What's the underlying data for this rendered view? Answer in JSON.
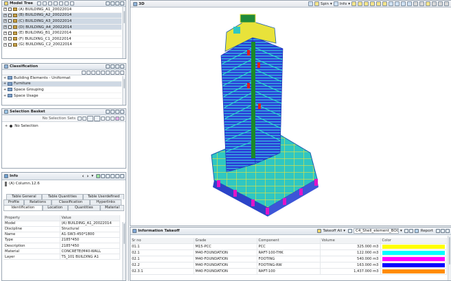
{
  "model_tree": {
    "title": "Model Tree",
    "items": [
      {
        "label": "(A) BUILDING_A1_20022014",
        "selected": false
      },
      {
        "label": "(B) BUILDING_A2_20022014",
        "selected": true
      },
      {
        "label": "(C) BUILDING_A3_20022014",
        "selected": true
      },
      {
        "label": "(D) BUILDING_A4_20022014",
        "selected": true
      },
      {
        "label": "(E) BUILDING_B1_20022014",
        "selected": false
      },
      {
        "label": "(F) BUILDING_C1_20022014",
        "selected": false
      },
      {
        "label": "(G) BUILDING_C2_20022014",
        "selected": false
      }
    ]
  },
  "classification": {
    "title": "Classification",
    "items": [
      "Building Elements - Uniformat",
      "Furniture",
      "Space Grouping",
      "Space Usage"
    ]
  },
  "selection_basket": {
    "title": "Selection Basket",
    "sets_label": "No Selection Sets",
    "no_selection": "No Selection"
  },
  "info": {
    "title": "Info",
    "element": "(A) Column.12.6",
    "tabs_row1": [
      "Table General",
      "Table Quantities",
      "Table Userdefined"
    ],
    "tabs_row2": [
      "Profile",
      "Relations",
      "Classification",
      "Hyperlinks"
    ],
    "tabs_row3": [
      "Identification",
      "Location",
      "Quantities",
      "Material"
    ],
    "headers": [
      "Property",
      "Value"
    ],
    "rows": [
      [
        "Model",
        "(A) BUILDING_A1_20022014"
      ],
      [
        "Discipline",
        "Structural"
      ],
      [
        "Name",
        "A1-SW3-450*1800"
      ],
      [
        "Type",
        "2185*450"
      ],
      [
        "Description",
        "2185*450"
      ],
      [
        "Material",
        "CONCRETE(M40-WALL"
      ],
      [
        "Layer",
        "TS_101 BUILDING A1"
      ]
    ]
  },
  "view3d": {
    "title": "3D",
    "spin": "Spin",
    "info": "Info"
  },
  "takeoff": {
    "title": "Information Takeoff",
    "takeoff_all": "Takeoff All",
    "schema": "C4_Shell_element_BOQ_g...",
    "report": "Report",
    "headers": [
      "Sr no",
      "Grade",
      "Component",
      "Volume",
      "Color"
    ],
    "rows": [
      {
        "sr": "01.1",
        "grade": "M15-PCC",
        "component": "PCC",
        "volume": "325.000 m3",
        "color": "#ffff00"
      },
      {
        "sr": "02.1",
        "grade": "M40-FOUNDATION",
        "component": "RAFT-100-THK",
        "volume": "122.000 m3",
        "color": "#00ffff"
      },
      {
        "sr": "02.1",
        "grade": "M40-FOUNDATION",
        "component": "FOOTING",
        "volume": "540.000 m3",
        "color": "#ff00ff"
      },
      {
        "sr": "02.2",
        "grade": "M40-FOUNDATION",
        "component": "FOOTING-RW",
        "volume": "163.000 m3",
        "color": "#0000ff"
      },
      {
        "sr": "02.3.1",
        "grade": "M40-FOUNDATION",
        "component": "RAFT-100",
        "volume": "1,437.000 m3",
        "color": "#ff8c00"
      }
    ]
  }
}
